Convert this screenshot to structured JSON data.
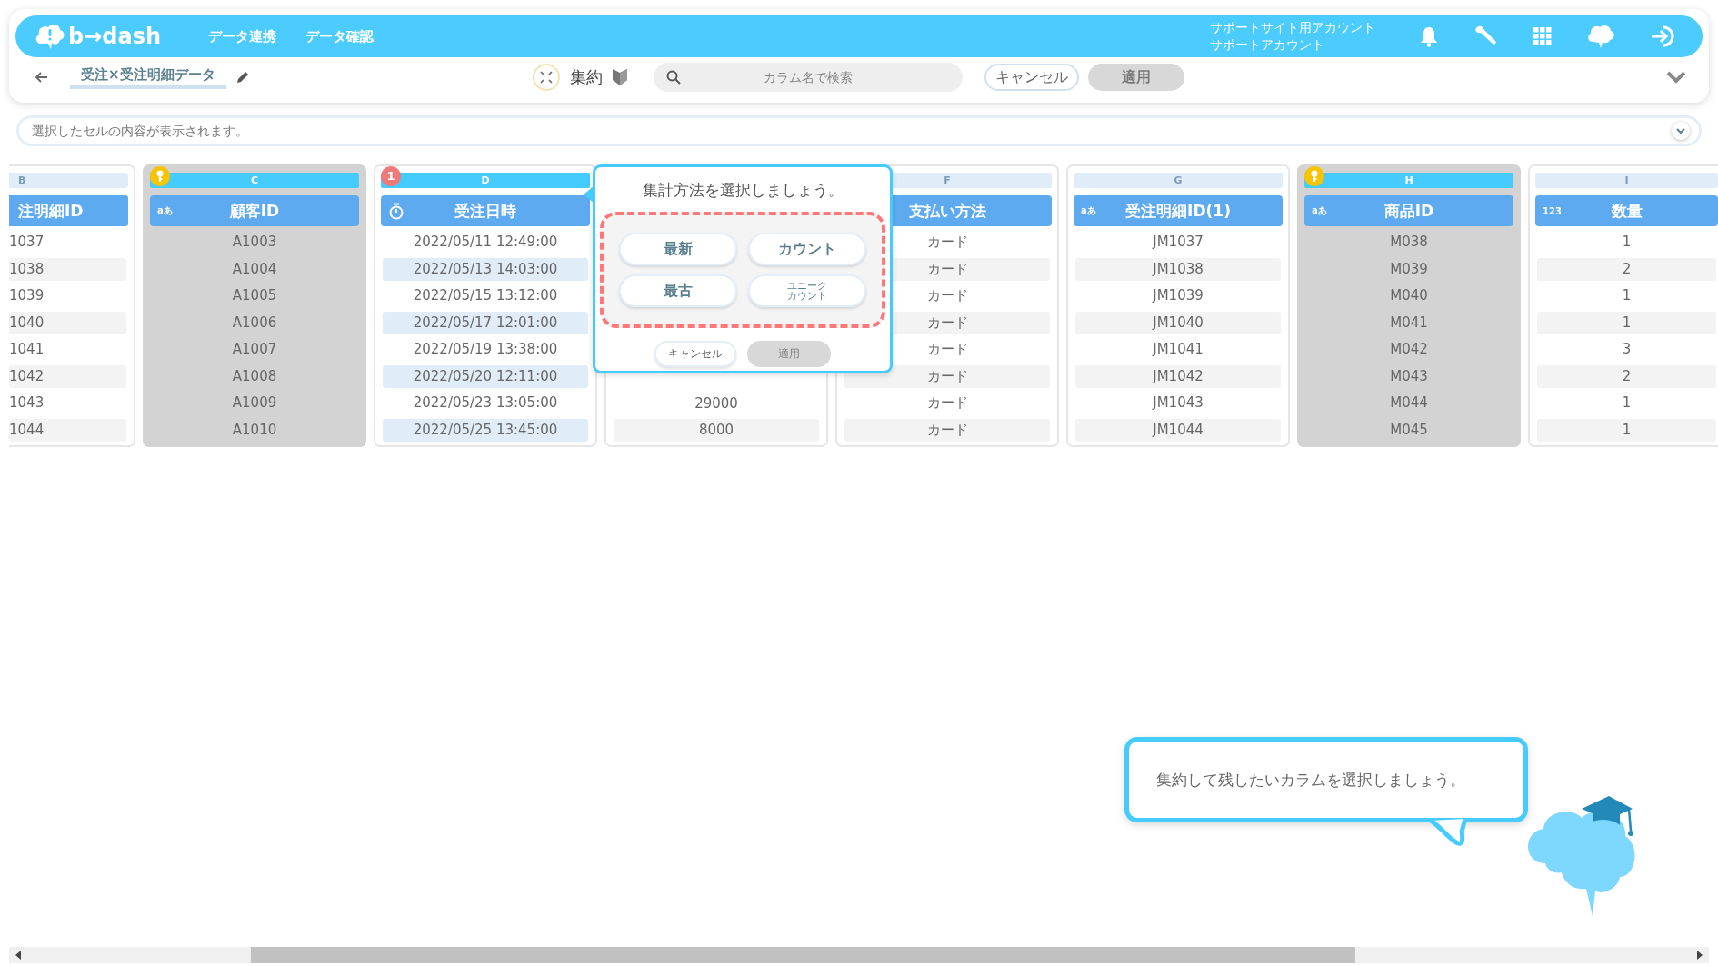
{
  "header": {
    "logo": "b→dash",
    "nav": [
      {
        "label": "データ連携",
        "selected": false
      },
      {
        "label": "データ確認",
        "selected": false
      }
    ],
    "account": {
      "line1": "サポートサイト用アカウント",
      "line2": "サポートアカウント"
    }
  },
  "toolbar": {
    "title": "受注×受注明細データ",
    "mode": "集約",
    "search": {
      "placeholder": "カラム名で検索"
    },
    "cancel": "キャンセル",
    "apply": {
      "label": "適用",
      "disabled": true
    }
  },
  "cell_viewer": {
    "placeholder": "選択したセルの内容が表示されます。"
  },
  "columns": [
    {
      "kind": "clipped",
      "letter": "B",
      "title": "注明細ID",
      "selected": false,
      "highlighted": false,
      "key": false,
      "cells": [
        "1037",
        "1038",
        "1039",
        "1040",
        "1041",
        "1042",
        "1043",
        "1044"
      ]
    },
    {
      "kind": "typed",
      "letter": "C",
      "title": "顧客ID",
      "type_label": "aあ",
      "selected": true,
      "highlighted": true,
      "key": true,
      "cells": [
        "A1003",
        "A1004",
        "A1005",
        "A1006",
        "A1007",
        "A1008",
        "A1009",
        "A1010"
      ]
    },
    {
      "kind": "datetime",
      "letter": "D",
      "title": "受注日時",
      "badge": "1",
      "selected": false,
      "highlighted": true,
      "key": false,
      "cells": [
        "2022/05/11 12:49:00",
        "2022/05/13 14:03:00",
        "2022/05/15 13:12:00",
        "2022/05/17 12:01:00",
        "2022/05/19 13:38:00",
        "2022/05/20 12:11:00",
        "2022/05/23 13:05:00",
        "2022/05/25 13:45:00"
      ]
    },
    {
      "kind": "covered",
      "selected": false,
      "cells": [
        "29000",
        "8000"
      ]
    },
    {
      "kind": "plain",
      "letter": "F",
      "title": "支払い方法",
      "selected": false,
      "highlighted": false,
      "key": false,
      "cells": [
        "カード",
        "カード",
        "カード",
        "カード",
        "カード",
        "カード",
        "カード",
        "カード"
      ]
    },
    {
      "kind": "typed",
      "letter": "G",
      "title": "受注明細ID(1)",
      "type_label": "aあ",
      "selected": false,
      "highlighted": false,
      "key": false,
      "cells": [
        "JM1037",
        "JM1038",
        "JM1039",
        "JM1040",
        "JM1041",
        "JM1042",
        "JM1043",
        "JM1044"
      ]
    },
    {
      "kind": "typed",
      "letter": "H",
      "title": "商品ID",
      "type_label": "aあ",
      "selected": true,
      "highlighted": true,
      "key": true,
      "cells": [
        "M038",
        "M039",
        "M040",
        "M041",
        "M042",
        "M043",
        "M044",
        "M045"
      ]
    },
    {
      "kind": "typed",
      "letter": "I",
      "title": "数量",
      "type_label": "123",
      "selected": false,
      "highlighted": false,
      "key": false,
      "cells": [
        "1",
        "2",
        "1",
        "1",
        "3",
        "2",
        "1",
        "1"
      ]
    }
  ],
  "popup": {
    "title": "集計方法を選択しましょう。",
    "options": [
      {
        "lines": [
          "最新"
        ],
        "selected": false
      },
      {
        "lines": [
          "カウント"
        ],
        "selected": false
      },
      {
        "lines": [
          "最古"
        ],
        "selected": false
      },
      {
        "lines": [
          "ユニーク",
          "カウント"
        ],
        "selected": false
      }
    ],
    "cancel": "キャンセル",
    "apply": {
      "label": "適用",
      "disabled": true
    }
  },
  "tip": "集約して残したいカラムを選択しましょう。"
}
